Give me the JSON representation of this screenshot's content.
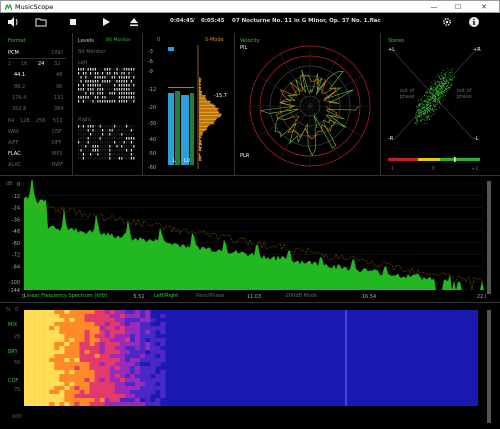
{
  "window": {
    "title": "MusicScope",
    "minimize": "—",
    "maximize": "☐",
    "close": "✕"
  },
  "toolbar": {
    "current_time": "0:04:45",
    "separator": "/",
    "total_time": "0:05:45",
    "track": "07 Nocturne No. 11 in G Minor, Op. 37 No. 1.flac"
  },
  "format_panel": {
    "title": "Format",
    "header": [
      "PCM",
      "DSD"
    ],
    "bits": [
      "1",
      "16",
      "24",
      "32"
    ],
    "rates_left": [
      "44.1",
      "88.2",
      "176.4",
      "352.8"
    ],
    "rates_right": [
      "48",
      "96",
      "192",
      "384"
    ],
    "dsd_rates": [
      "64",
      "128",
      "256",
      "512"
    ],
    "codecs_left": [
      "WAV",
      "AIFF",
      "FLAC",
      "ALAC"
    ],
    "codecs_right": [
      "DSF",
      "DFF",
      "MP3",
      "BWF"
    ]
  },
  "levels_panel": {
    "title": "Levels",
    "mode": "Bit Monitor",
    "sub_mode": "Bit Monitor",
    "left": "Left",
    "right": "Right"
  },
  "meter_panel": {
    "scale_top": "0",
    "mode": "S-Mode",
    "scale": [
      "-3",
      "-6",
      "-9",
      "-12",
      "-20",
      "-30",
      "-40",
      "-50",
      "-60"
    ],
    "peak_value": "-15.7",
    "channel_left": "L",
    "channel_right": "LU"
  },
  "velocity_panel": {
    "title": "Velocity",
    "pil": "PIL",
    "plr": "PLR"
  },
  "stereo_panel": {
    "title": "Stereo",
    "plus_l": "+L",
    "plus_r": "+R",
    "minus_l": "-R",
    "minus_r": "-L",
    "out_left": "out of phase",
    "out_right": "out of phase",
    "corr_min": "-1",
    "corr_mid": "0",
    "corr_max": "+1"
  },
  "spectrum_panel": {
    "db_label": "dB",
    "y_ticks": [
      "0",
      "-12",
      "-24",
      "-36",
      "-48",
      "-60",
      "-72",
      "-84",
      "-100",
      "-144"
    ],
    "x_ticks": [
      "5.51",
      "11.03",
      "16.54",
      "22.05"
    ],
    "mode_label": "Linear Frequency Spectrum (kHz)",
    "left_right": "Left/Right",
    "pans_phase": "Pans/Phase",
    "db_mode": "-200dB Mode",
    "zero": "0"
  },
  "spectrogram_panel": {
    "pct": "%",
    "y_ticks": [
      "25",
      "50",
      "75",
      "100"
    ],
    "side_labels": [
      "MIX",
      "BRY",
      "COF"
    ],
    "zero": "0"
  }
}
